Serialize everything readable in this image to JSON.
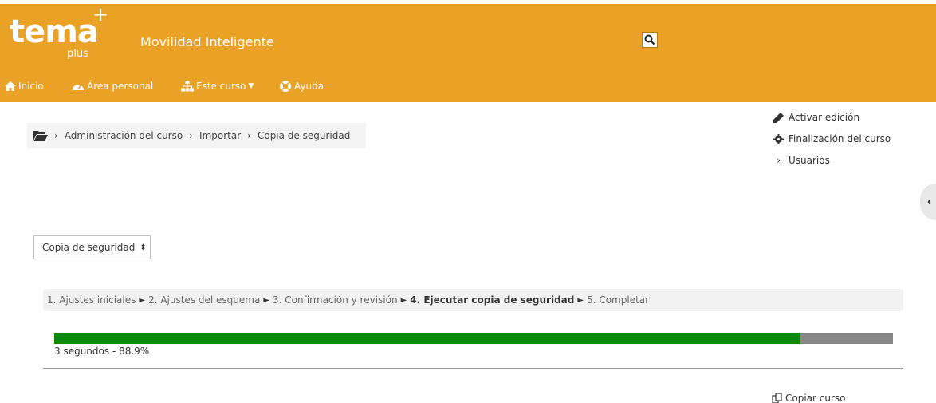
{
  "logo": {
    "main": "tema",
    "plus": "+",
    "sub": "plus"
  },
  "site": {
    "name": "Movilidad Inteligente"
  },
  "nav": {
    "home": "Inicio",
    "dashboard": "Área personal",
    "this_course": "Este curso",
    "help": "Ayuda"
  },
  "breadcrumb": {
    "items": [
      "Administración del curso",
      "Importar",
      "Copia de seguridad"
    ]
  },
  "actions": {
    "edit": "Activar edición",
    "completion": "Finalización del curso",
    "users": "Usuarios"
  },
  "backup_select": {
    "value": "Copia de seguridad"
  },
  "steps": {
    "s1": "1. Ajustes iniciales",
    "s2": "2. Ajustes del esquema",
    "s3": "3. Confirmación y revisión",
    "s4": "4. Ejecutar copia de seguridad",
    "s5": "5. Completar"
  },
  "progress": {
    "fraction": 0.889,
    "label": "3 segundos - 88.9%"
  },
  "footer": {
    "copy_course": "Copiar curso"
  },
  "colors": {
    "header": "#e9a126",
    "progress_fill": "#0a8a0a",
    "progress_track": "#888888"
  }
}
